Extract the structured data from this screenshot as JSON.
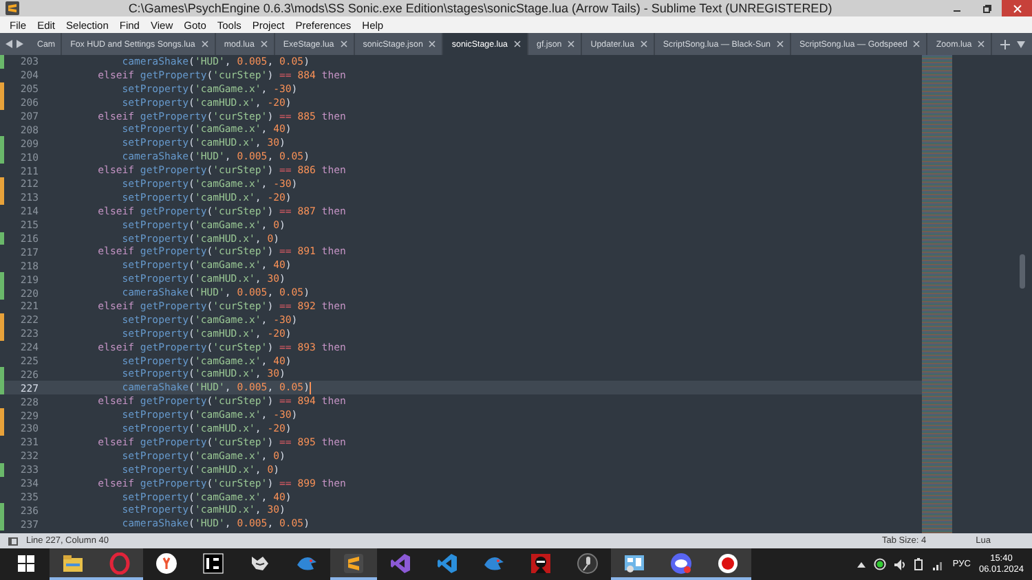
{
  "window": {
    "title": "C:\\Games\\PsychEngine 0.6.3\\mods\\SS Sonic.exe Edition\\stages\\sonicStage.lua (Arrow Tails) - Sublime Text (UNREGISTERED)"
  },
  "menu": [
    "File",
    "Edit",
    "Selection",
    "Find",
    "View",
    "Goto",
    "Tools",
    "Project",
    "Preferences",
    "Help"
  ],
  "tabs": [
    {
      "label": "Cam",
      "selected": false
    },
    {
      "label": "Fox HUD and Settings Songs.lua",
      "selected": false
    },
    {
      "label": "mod.lua",
      "selected": false
    },
    {
      "label": "ExeStage.lua",
      "selected": false
    },
    {
      "label": "sonicStage.json",
      "selected": false
    },
    {
      "label": "sonicStage.lua",
      "selected": true
    },
    {
      "label": "gf.json",
      "selected": false
    },
    {
      "label": "Updater.lua",
      "selected": false
    },
    {
      "label": "ScriptSong.lua — Black-Sun",
      "selected": false
    },
    {
      "label": "ScriptSong.lua — Godspeed",
      "selected": false
    },
    {
      "label": "Zoom.lua",
      "selected": false
    }
  ],
  "editor": {
    "lines": [
      {
        "number": "203",
        "text": "            cameraShake('HUD', 0.005, 0.05)",
        "color": "#6ab86a",
        "current": false
      },
      {
        "number": "204",
        "text": "        elseif getProperty('curStep') == 884 then",
        "current": false
      },
      {
        "number": "205",
        "text": "            setProperty('camGame.x', -30)",
        "color": "#e8a23a",
        "current": false
      },
      {
        "number": "206",
        "text": "            setProperty('camHUD.x', -20)",
        "color": "#e8a23a",
        "current": false
      },
      {
        "number": "207",
        "text": "        elseif getProperty('curStep') == 885 then",
        "current": false
      },
      {
        "number": "208",
        "text": "            setProperty('camGame.x', 40)",
        "current": false
      },
      {
        "number": "209",
        "text": "            setProperty('camHUD.x', 30)",
        "color": "#6ab86a",
        "current": false
      },
      {
        "number": "210",
        "text": "            cameraShake('HUD', 0.005, 0.05)",
        "color": "#6ab86a",
        "current": false
      },
      {
        "number": "211",
        "text": "        elseif getProperty('curStep') == 886 then",
        "current": false
      },
      {
        "number": "212",
        "text": "            setProperty('camGame.x', -30)",
        "color": "#e8a23a",
        "current": false
      },
      {
        "number": "213",
        "text": "            setProperty('camHUD.x', -20)",
        "color": "#e8a23a",
        "current": false
      },
      {
        "number": "214",
        "text": "        elseif getProperty('curStep') == 887 then",
        "current": false
      },
      {
        "number": "215",
        "text": "            setProperty('camGame.x', 0)",
        "current": false
      },
      {
        "number": "216",
        "text": "            setProperty('camHUD.x', 0)",
        "color": "#6ab86a",
        "current": false
      },
      {
        "number": "217",
        "text": "        elseif getProperty('curStep') == 891 then",
        "current": false
      },
      {
        "number": "218",
        "text": "            setProperty('camGame.x', 40)",
        "current": false
      },
      {
        "number": "219",
        "text": "            setProperty('camHUD.x', 30)",
        "color": "#6ab86a",
        "current": false
      },
      {
        "number": "220",
        "text": "            cameraShake('HUD', 0.005, 0.05)",
        "color": "#6ab86a",
        "current": false
      },
      {
        "number": "221",
        "text": "        elseif getProperty('curStep') == 892 then",
        "current": false
      },
      {
        "number": "222",
        "text": "            setProperty('camGame.x', -30)",
        "color": "#e8a23a",
        "current": false
      },
      {
        "number": "223",
        "text": "            setProperty('camHUD.x', -20)",
        "color": "#e8a23a",
        "current": false
      },
      {
        "number": "224",
        "text": "        elseif getProperty('curStep') == 893 then",
        "current": false
      },
      {
        "number": "225",
        "text": "            setProperty('camGame.x', 40)",
        "current": false
      },
      {
        "number": "226",
        "text": "            setProperty('camHUD.x', 30)",
        "color": "#6ab86a",
        "current": false
      },
      {
        "number": "227",
        "text": "            cameraShake('HUD', 0.005, 0.05)",
        "color": "#6ab86a",
        "current": true
      },
      {
        "number": "228",
        "text": "        elseif getProperty('curStep') == 894 then",
        "current": false
      },
      {
        "number": "229",
        "text": "            setProperty('camGame.x', -30)",
        "color": "#e8a23a",
        "current": false
      },
      {
        "number": "230",
        "text": "            setProperty('camHUD.x', -20)",
        "color": "#e8a23a",
        "current": false
      },
      {
        "number": "231",
        "text": "        elseif getProperty('curStep') == 895 then",
        "current": false
      },
      {
        "number": "232",
        "text": "            setProperty('camGame.x', 0)",
        "current": false
      },
      {
        "number": "233",
        "text": "            setProperty('camHUD.x', 0)",
        "color": "#6ab86a",
        "current": false
      },
      {
        "number": "234",
        "text": "        elseif getProperty('curStep') == 899 then",
        "current": false
      },
      {
        "number": "235",
        "text": "            setProperty('camGame.x', 40)",
        "current": false
      },
      {
        "number": "236",
        "text": "            setProperty('camHUD.x', 30)",
        "color": "#6ab86a",
        "current": false
      },
      {
        "number": "237",
        "text": "            cameraShake('HUD', 0.005, 0.05)",
        "color": "#6ab86a",
        "current": false
      }
    ]
  },
  "status_bar": {
    "position": "Line 227, Column 40",
    "tab_size": "Tab Size: 4",
    "syntax": "Lua"
  },
  "taskbar": {
    "apps": [
      {
        "kind": "folder",
        "active": true
      },
      {
        "kind": "opera",
        "active": true
      },
      {
        "kind": "yandex",
        "active": false
      },
      {
        "kind": "ps",
        "active": false
      },
      {
        "kind": "wolf",
        "active": false
      },
      {
        "kind": "bird",
        "active": false
      },
      {
        "kind": "sublime",
        "active": true
      },
      {
        "kind": "vs",
        "active": false
      },
      {
        "kind": "vscode",
        "active": false
      },
      {
        "kind": "bird",
        "active": false
      },
      {
        "kind": "ninja",
        "active": false
      },
      {
        "kind": "mic",
        "active": false
      },
      {
        "kind": "viewer",
        "active": true
      },
      {
        "kind": "discord",
        "active": true
      },
      {
        "kind": "record",
        "active": true
      }
    ],
    "language": "РУС",
    "time": "15:40",
    "date": "06.01.2024"
  }
}
